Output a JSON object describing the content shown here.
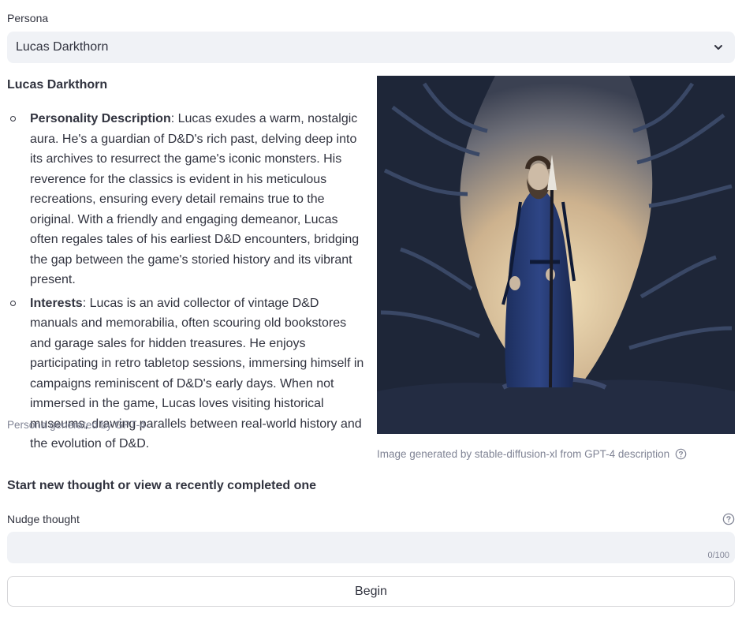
{
  "persona_select": {
    "label": "Persona",
    "selected": "Lucas Darkthorn"
  },
  "persona": {
    "name": "Lucas Darkthorn",
    "bullets": [
      {
        "title": "Personality Description",
        "text": ": Lucas exudes a warm, nostalgic aura. He's a guardian of D&D's rich past, delving deep into its archives to resurrect the game's iconic monsters. His reverence for the classics is evident in his meticulous recreations, ensuring every detail remains true to the original. With a friendly and engaging demeanor, Lucas often regales tales of his earliest D&D encounters, bridging the gap between the game's storied history and its vibrant present."
      },
      {
        "title": "Interests",
        "text": ": Lucas is an avid collector of vintage D&D manuals and memorabilia, often scouring old bookstores and garage sales for hidden treasures. He enjoys participating in retro tabletop sessions, immersing himself in campaigns reminiscent of D&D's early days. When not immersed in the game, Lucas loves visiting historical museums, drawing parallels between real-world history and the evolution of D&D."
      }
    ],
    "caption": "Persona generated by GPT-4"
  },
  "image": {
    "caption": "Image generated by stable-diffusion-xl from GPT-4 description"
  },
  "thought": {
    "heading": "Start new thought or view a recently completed one",
    "nudge_label": "Nudge thought",
    "nudge_value": "",
    "counter": "0/100",
    "begin_label": "Begin"
  },
  "colors": {
    "input_bg": "#f0f2f6",
    "text": "#31333f",
    "muted": "#808495"
  }
}
